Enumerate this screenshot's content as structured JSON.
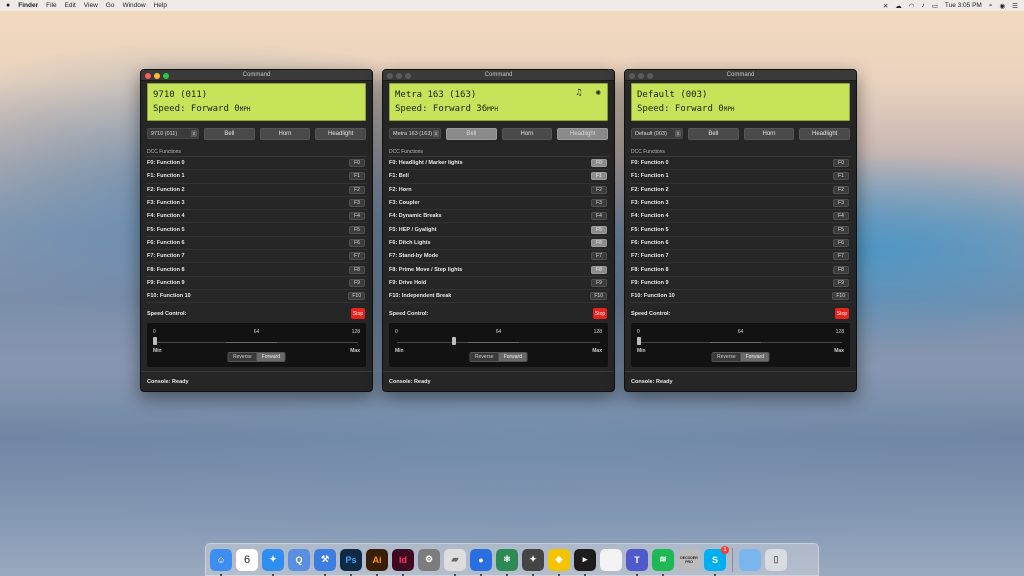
{
  "menubar": {
    "app": "Finder",
    "items": [
      "File",
      "Edit",
      "View",
      "Go",
      "Window",
      "Help"
    ],
    "clock": "Tue 3:05 PM"
  },
  "windows": [
    {
      "title": "Command",
      "lcd_line1": "9710 (011)",
      "lcd_line2": "Speed: Forward 0",
      "lcd_unit": "MPH",
      "lcd_icons": [],
      "select": "9710 (011)",
      "buttons": [
        {
          "label": "Bell",
          "active": false
        },
        {
          "label": "Horn",
          "active": false
        },
        {
          "label": "Headlight",
          "active": false
        }
      ],
      "section": "DCC Functions",
      "functions": [
        {
          "name": "F0: Function 0",
          "key": "F0",
          "on": false
        },
        {
          "name": "F1: Function 1",
          "key": "F1",
          "on": false
        },
        {
          "name": "F2: Function 2",
          "key": "F2",
          "on": false
        },
        {
          "name": "F3: Function 3",
          "key": "F3",
          "on": false
        },
        {
          "name": "F4: Function 4",
          "key": "F4",
          "on": false
        },
        {
          "name": "F5: Function 5",
          "key": "F5",
          "on": false
        },
        {
          "name": "F6: Function 6",
          "key": "F6",
          "on": false
        },
        {
          "name": "F7: Function 7",
          "key": "F7",
          "on": false
        },
        {
          "name": "F8: Function 8",
          "key": "F8",
          "on": false
        },
        {
          "name": "F9: Function 9",
          "key": "F9",
          "on": false
        },
        {
          "name": "F10: Function 10",
          "key": "F10",
          "on": false
        }
      ],
      "speed_label": "Speed Control:",
      "stop": "Stop",
      "ticks": [
        "0",
        "64",
        "128"
      ],
      "speed_value": 0,
      "min": "Min",
      "max": "Max",
      "reverse": "Reverse",
      "forward": "Forward",
      "direction": "forward",
      "console": "Console: Ready"
    },
    {
      "title": "Command",
      "lcd_line1": "Metra 163 (163)",
      "lcd_line2": "Speed: Forward 36",
      "lcd_unit": "MPH",
      "lcd_icons": [
        "bell-icon",
        "headlight-icon"
      ],
      "select": "Metra 163 (163)",
      "buttons": [
        {
          "label": "Bell",
          "active": true
        },
        {
          "label": "Horn",
          "active": false
        },
        {
          "label": "Headlight",
          "active": true
        }
      ],
      "section": "DCC Functions",
      "functions": [
        {
          "name": "F0: Headlight / Marker lights",
          "key": "F0",
          "on": true
        },
        {
          "name": "F1: Bell",
          "key": "F1",
          "on": true
        },
        {
          "name": "F2: Horn",
          "key": "F2",
          "on": false
        },
        {
          "name": "F3: Coupler",
          "key": "F3",
          "on": false
        },
        {
          "name": "F4: Dynamic Breaks",
          "key": "F4",
          "on": false
        },
        {
          "name": "F5: HEP / Gyalight",
          "key": "F5",
          "on": true
        },
        {
          "name": "F6: Ditch Lights",
          "key": "F6",
          "on": true
        },
        {
          "name": "F7: Stand-by Mode",
          "key": "F7",
          "on": false
        },
        {
          "name": "F8: Prime Move / Step lights",
          "key": "F8",
          "on": true
        },
        {
          "name": "F9: Drive Hold",
          "key": "F9",
          "on": false
        },
        {
          "name": "F10: Independent Break",
          "key": "F10",
          "on": false
        }
      ],
      "speed_label": "Speed Control:",
      "stop": "Stop",
      "ticks": [
        "0",
        "64",
        "128"
      ],
      "speed_value": 36,
      "min": "Min",
      "max": "Max",
      "reverse": "Reverse",
      "forward": "Forward",
      "direction": "forward",
      "console": "Console: Ready"
    },
    {
      "title": "Command",
      "lcd_line1": "Default (003)",
      "lcd_line2": "Speed: Forward 0",
      "lcd_unit": "MPH",
      "lcd_icons": [],
      "select": "Default (003)",
      "buttons": [
        {
          "label": "Bell",
          "active": false
        },
        {
          "label": "Horn",
          "active": false
        },
        {
          "label": "Headlight",
          "active": false
        }
      ],
      "section": "DCC Functions",
      "functions": [
        {
          "name": "F0: Function 0",
          "key": "F0",
          "on": false
        },
        {
          "name": "F1: Function 1",
          "key": "F1",
          "on": false
        },
        {
          "name": "F2: Function 2",
          "key": "F2",
          "on": false
        },
        {
          "name": "F3: Function 3",
          "key": "F3",
          "on": false
        },
        {
          "name": "F4: Function 4",
          "key": "F4",
          "on": false
        },
        {
          "name": "F5: Function 5",
          "key": "F5",
          "on": false
        },
        {
          "name": "F6: Function 6",
          "key": "F6",
          "on": false
        },
        {
          "name": "F7: Function 7",
          "key": "F7",
          "on": false
        },
        {
          "name": "F8: Function 8",
          "key": "F8",
          "on": false
        },
        {
          "name": "F9: Function 9",
          "key": "F9",
          "on": false
        },
        {
          "name": "F10: Function 10",
          "key": "F10",
          "on": false
        }
      ],
      "speed_label": "Speed Control:",
      "stop": "Stop",
      "ticks": [
        "0",
        "64",
        "128"
      ],
      "speed_value": 0,
      "min": "Min",
      "max": "Max",
      "reverse": "Reverse",
      "forward": "Forward",
      "direction": "forward",
      "console": "Console: Ready"
    }
  ],
  "dock": {
    "calendar_day": "6",
    "apps": [
      {
        "icon": "finder-icon",
        "color": "#3d8ef0",
        "glyph": "☺"
      },
      {
        "icon": "calendar-icon",
        "color": "#ffffff",
        "glyph": ""
      },
      {
        "icon": "safari-icon",
        "color": "#2e8ef2",
        "glyph": "✦"
      },
      {
        "icon": "quicktime-icon",
        "color": "#5a8fe0",
        "glyph": "Q"
      },
      {
        "icon": "xcode-icon",
        "color": "#3b7de0",
        "glyph": "⚒"
      },
      {
        "icon": "photoshop-icon",
        "color": "#0f2a45",
        "glyph": ""
      },
      {
        "icon": "illustrator-icon",
        "color": "#3a1f08",
        "glyph": ""
      },
      {
        "icon": "indesign-icon",
        "color": "#3d0a22",
        "glyph": ""
      },
      {
        "icon": "system-preferences-icon",
        "color": "#7c7c7c",
        "glyph": "⚙"
      },
      {
        "icon": "storage-icon",
        "color": "#dddddd",
        "glyph": "▰"
      },
      {
        "icon": "maps-pin-icon",
        "color": "#2a6fe0",
        "glyph": "●"
      },
      {
        "icon": "atom-icon",
        "color": "#2d8a55",
        "glyph": "⚛"
      },
      {
        "icon": "safari-tech-icon",
        "color": "#444444",
        "glyph": "✦"
      },
      {
        "icon": "duck-icon",
        "color": "#f5c400",
        "glyph": "◆"
      },
      {
        "icon": "terminal-icon",
        "color": "#1d1d1d",
        "glyph": "▸"
      },
      {
        "icon": "document-icon",
        "color": "#f3f3f3",
        "glyph": ""
      },
      {
        "icon": "teams-icon",
        "color": "#5059c9",
        "glyph": "T"
      },
      {
        "icon": "spotify-icon",
        "color": "#1db954",
        "glyph": "≋"
      },
      {
        "icon": "decoder-pro-icon",
        "color": "#bbbbbb",
        "glyph": ""
      },
      {
        "icon": "skype-icon",
        "color": "#00aff0",
        "glyph": "S"
      },
      {
        "icon": "folder-icon",
        "color": "#7ab6ee",
        "glyph": ""
      },
      {
        "icon": "trash-icon",
        "color": "#d9dde2",
        "glyph": "▯"
      }
    ],
    "labels": {
      "ps": "Ps",
      "ai": "Ai",
      "id": "Id",
      "decoder_pro": "DECODER PRO",
      "skype_badge": "1"
    }
  }
}
